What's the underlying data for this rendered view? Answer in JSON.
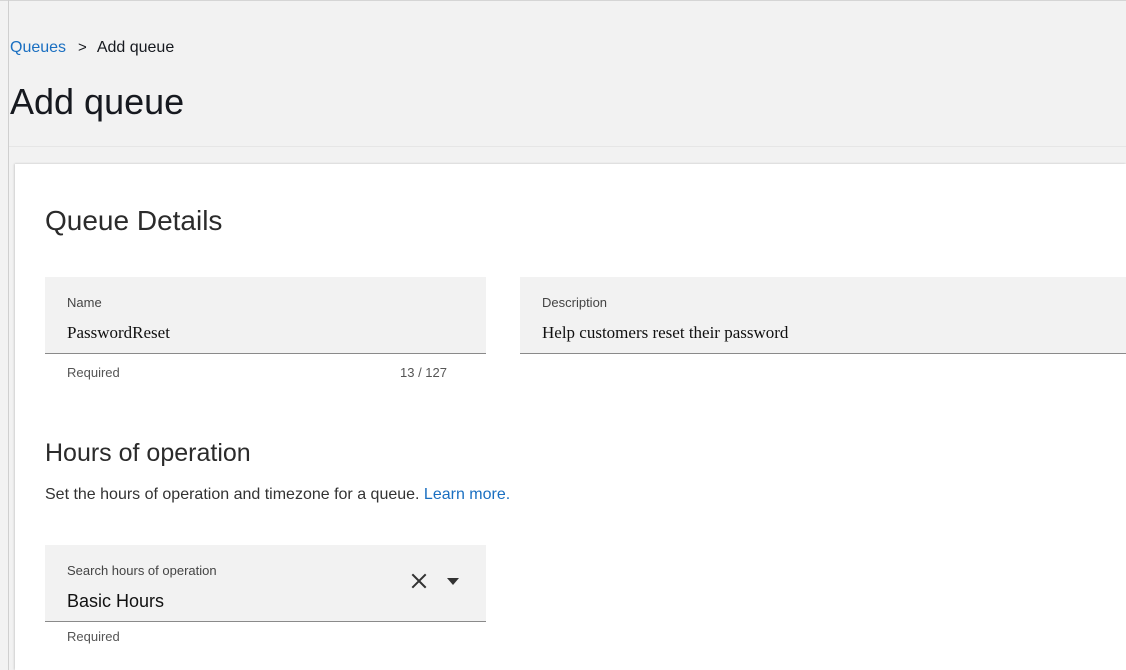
{
  "breadcrumb": {
    "parent": "Queues",
    "separator": ">",
    "current": "Add queue"
  },
  "page": {
    "title": "Add queue"
  },
  "queue_details": {
    "title": "Queue Details",
    "name": {
      "label": "Name",
      "value": "PasswordReset",
      "helper": "Required",
      "count": "13 / 127"
    },
    "description": {
      "label": "Description",
      "value": "Help customers reset their password"
    }
  },
  "hours": {
    "title": "Hours of operation",
    "description": "Set the hours of operation and timezone for a queue. ",
    "learn_more": "Learn more.",
    "search": {
      "label": "Search hours of operation",
      "value": "Basic Hours",
      "helper": "Required"
    }
  },
  "icons": {
    "breadcrumb_separator": "chevron-right-icon",
    "clear": "close-icon",
    "dropdown": "caret-down-icon"
  },
  "colors": {
    "link": "#1a6fc1",
    "background": "#f2f2f2",
    "card": "#ffffff"
  }
}
